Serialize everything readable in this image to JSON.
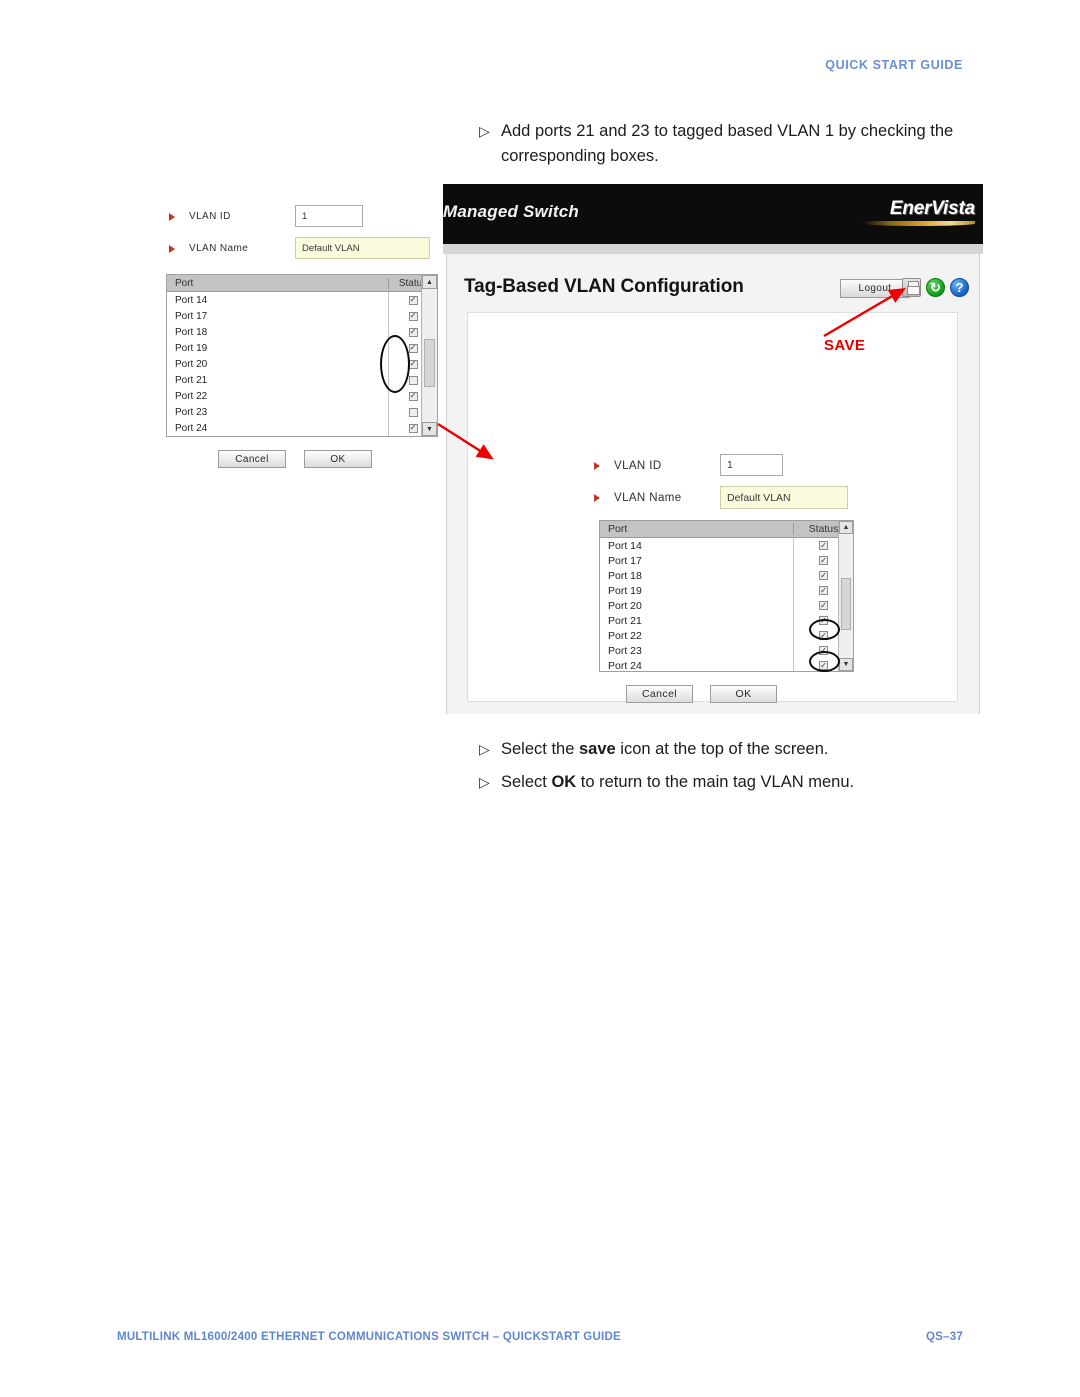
{
  "page": {
    "header_label": "QUICK START GUIDE",
    "footer_left": "MULTILINK ML1600/2400 ETHERNET COMMUNICATIONS SWITCH – QUICKSTART GUIDE",
    "footer_right": "QS–37"
  },
  "instructions_top": [
    {
      "marker": "▷",
      "text": "Add ports 21 and 23 to tagged based VLAN 1 by checking the corresponding boxes."
    }
  ],
  "instructions_bottom": [
    {
      "marker": "▷",
      "pre": "Select the ",
      "bold": "save",
      "post": " icon at the top of the screen."
    },
    {
      "marker": "▷",
      "pre": "Select ",
      "bold": "OK",
      "post": " to return to the main tag VLAN menu."
    }
  ],
  "annotations": {
    "save_label": "SAVE",
    "save_color": "#e00000",
    "arrow_color": "#ee0000",
    "circle_color": "#0c0c0c"
  },
  "small_screenshot": {
    "vlan_id_label": "VLAN ID",
    "vlan_id_value": "1",
    "vlan_name_label": "VLAN Name",
    "vlan_name_value": "Default VLAN",
    "vlan_name_bg": "#fafadc",
    "table": {
      "col_port": "Port",
      "col_status": "Status",
      "header_bg": "#c3c3c3",
      "rows": [
        {
          "port": "Port 14",
          "checked": true
        },
        {
          "port": "Port 17",
          "checked": true
        },
        {
          "port": "Port 18",
          "checked": true
        },
        {
          "port": "Port 19",
          "checked": true
        },
        {
          "port": "Port 20",
          "checked": true
        },
        {
          "port": "Port 21",
          "checked": false
        },
        {
          "port": "Port 22",
          "checked": true
        },
        {
          "port": "Port 23",
          "checked": false
        },
        {
          "port": "Port 24",
          "checked": true
        }
      ],
      "scroll_up": "▲",
      "scroll_down": "▼"
    },
    "cancel_label": "Cancel",
    "ok_label": "OK"
  },
  "big_screenshot": {
    "brand_left": "Managed Switch",
    "brand_right": "EnerVista",
    "page_title": "Tag-Based VLAN Configuration",
    "logout_label": "Logout",
    "icons": [
      {
        "name": "save-icon",
        "glyph": ""
      },
      {
        "name": "refresh-icon",
        "glyph": "↻"
      },
      {
        "name": "help-icon",
        "glyph": "?"
      }
    ],
    "vlan_id_label": "VLAN ID",
    "vlan_id_value": "1",
    "vlan_name_label": "VLAN Name",
    "vlan_name_value": "Default VLAN",
    "vlan_name_bg": "#fafadc",
    "table": {
      "col_port": "Port",
      "col_status": "Status",
      "header_bg": "#c3c3c3",
      "rows": [
        {
          "port": "Port 14",
          "checked": true
        },
        {
          "port": "Port 17",
          "checked": true
        },
        {
          "port": "Port 18",
          "checked": true
        },
        {
          "port": "Port 19",
          "checked": true
        },
        {
          "port": "Port 20",
          "checked": true
        },
        {
          "port": "Port 21",
          "checked": true
        },
        {
          "port": "Port 22",
          "checked": true
        },
        {
          "port": "Port 23",
          "checked": true
        },
        {
          "port": "Port 24",
          "checked": true
        }
      ],
      "scroll_up": "▲",
      "scroll_down": "▼"
    },
    "cancel_label": "Cancel",
    "ok_label": "OK"
  }
}
